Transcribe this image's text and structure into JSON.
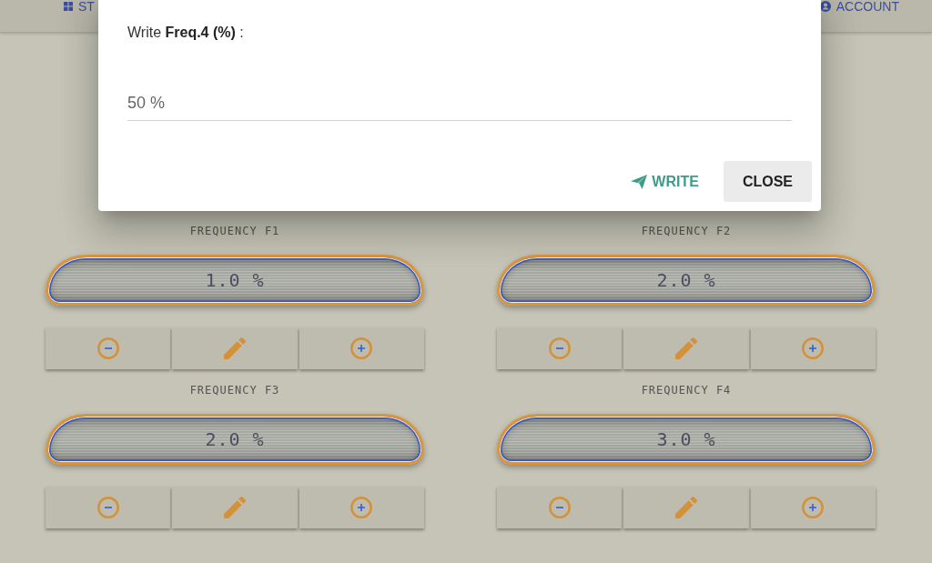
{
  "header": {
    "left_item": {
      "label": "ST"
    },
    "right_item": {
      "label": "ACCOUNT"
    }
  },
  "dialog": {
    "prompt": "Write **Freq.4 (%)** :",
    "field": {
      "value": "50 %"
    },
    "buttons": [
      {
        "kind": "send",
        "label": "WRITE"
      },
      {
        "kind": "plain",
        "label": "CLOSE"
      }
    ]
  },
  "frequency_cards": [
    {
      "label": "FREQUENCY F1",
      "reading": "1.0 %"
    },
    {
      "label": "FREQUENCY F2",
      "reading": "2.0 %"
    },
    {
      "label": "FREQUENCY F3",
      "reading": "2.0 %"
    },
    {
      "label": "FREQUENCY F4",
      "reading": "3.0 %"
    }
  ]
}
